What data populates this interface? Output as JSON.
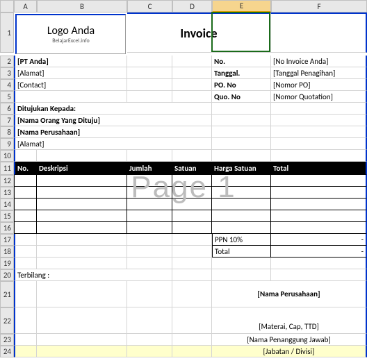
{
  "cols": [
    "A",
    "B",
    "C",
    "D",
    "E",
    "F"
  ],
  "rows": [
    "1",
    "2",
    "3",
    "4",
    "5",
    "6",
    "7",
    "8",
    "9",
    "10",
    "11",
    "12",
    "13",
    "14",
    "15",
    "16",
    "17",
    "18",
    "19",
    "20",
    "21",
    "22",
    "23",
    "24"
  ],
  "logo": {
    "title": "Logo Anda",
    "sub": "BelajarExcel.info"
  },
  "title": "Invoice",
  "sender": {
    "company": "[PT Anda]",
    "address": "[Alamat]",
    "contact": "[Contact]"
  },
  "meta": {
    "no_label": "No.",
    "no_value": "[No Invoice Anda]",
    "date_label": "Tanggal.",
    "date_value": "[Tanggal Penagihan]",
    "po_label": "PO. No",
    "po_value": "[Nomor PO]",
    "quo_label": "Quo. No",
    "quo_value": "[Nomor Quotation]"
  },
  "recipient": {
    "heading": "Ditujukan Kepada:",
    "name": "[Nama Orang Yang Dituju]",
    "company": "[Nama Perusahaan]",
    "address": "[Alamat]"
  },
  "table": {
    "headers": {
      "no": "No.",
      "desc": "Deskripsi",
      "qty": "Jumlah",
      "unit": "Satuan",
      "price": "Harga Satuan",
      "total": "Total"
    }
  },
  "summary": {
    "ppn_label": "PPN 10%",
    "ppn_value": "-",
    "total_label": "Total",
    "total_value": "-"
  },
  "terbilang_label": "Terbilang :",
  "sign": {
    "company": "[Nama Perusahaan]",
    "stamp": "[Materai, Cap, TTD]",
    "person": "[Nama Penanggung Jawab]",
    "role": "[Jabatan / Divisi]"
  },
  "watermark": "Page 1",
  "selected_col": "E"
}
